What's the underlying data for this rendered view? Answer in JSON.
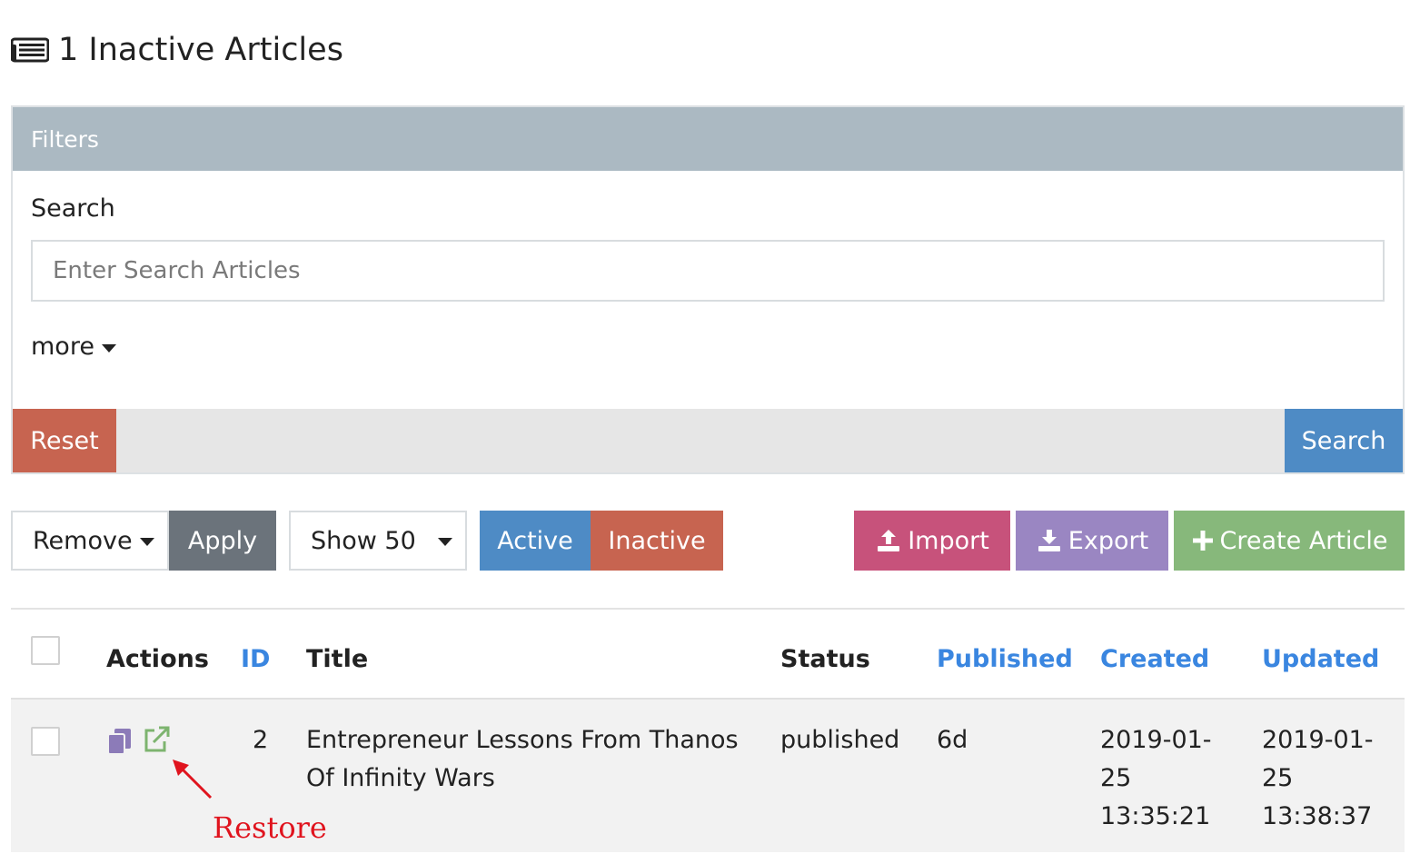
{
  "page": {
    "title": "1 Inactive Articles",
    "title_icon": "newspaper-icon"
  },
  "filters": {
    "header": "Filters",
    "search_label": "Search",
    "search_value": "",
    "search_placeholder": "Enter Search Articles",
    "more_label": "more",
    "reset_label": "Reset",
    "search_button_label": "Search"
  },
  "toolbar": {
    "bulk_action": {
      "selected": "Remove"
    },
    "apply_label": "Apply",
    "page_size": {
      "selected": "Show 50"
    },
    "active_label": "Active",
    "inactive_label": "Inactive",
    "import_label": "Import",
    "export_label": "Export",
    "create_label": "Create Article",
    "colors": {
      "active": "#4e8bc5",
      "inactive": "#c76450",
      "import": "#c7527b",
      "export": "#9a86c2",
      "create": "#87b87b",
      "apply": "#6b737b"
    }
  },
  "table": {
    "columns": {
      "actions": "Actions",
      "id": "ID",
      "title": "Title",
      "status": "Status",
      "published": "Published",
      "created": "Created",
      "updated": "Updated"
    },
    "link_color": "#3a86e0",
    "rows": [
      {
        "id": "2",
        "title_line1": "Entrepreneur Lessons From Thanos",
        "title_line2": "Of Infinity Wars",
        "status": "published",
        "published": "6d",
        "created_line1": "2019-01-",
        "created_line2": "25",
        "created_line3": "13:35:21",
        "updated_line1": "2019-01-",
        "updated_line2": "25",
        "updated_line3": "13:38:37",
        "actions": [
          "copy-icon",
          "restore-icon"
        ]
      }
    ]
  },
  "annotation": {
    "text": "Restore",
    "color": "#e0141e"
  }
}
